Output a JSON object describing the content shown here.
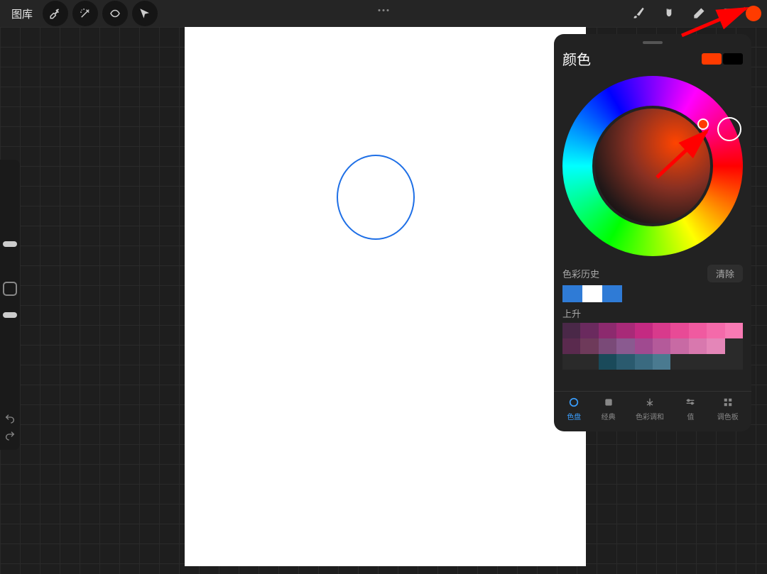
{
  "topbar": {
    "gallery": "图库"
  },
  "panel": {
    "title": "颜色",
    "history_label": "色彩历史",
    "clear": "清除",
    "trending_label": "上升",
    "tabs": {
      "disc": "色盘",
      "classic": "经典",
      "harmony": "色彩调和",
      "value": "值",
      "palettes": "调色板"
    }
  },
  "colors": {
    "current": "#ff3b00",
    "primary_swatch": "#ff3b00",
    "secondary_swatch": "#000000",
    "history": [
      "#2f7bd6",
      "#ffffff",
      "#2f7bd6"
    ]
  },
  "icons": {
    "wrench": "wrench-icon",
    "wand": "wand-icon",
    "select": "select-icon",
    "arrow": "arrow-icon",
    "brush": "brush-icon",
    "smudge": "smudge-icon",
    "eraser": "eraser-icon",
    "layers": "layers-icon",
    "undo": "undo-icon",
    "redo": "redo-icon"
  }
}
